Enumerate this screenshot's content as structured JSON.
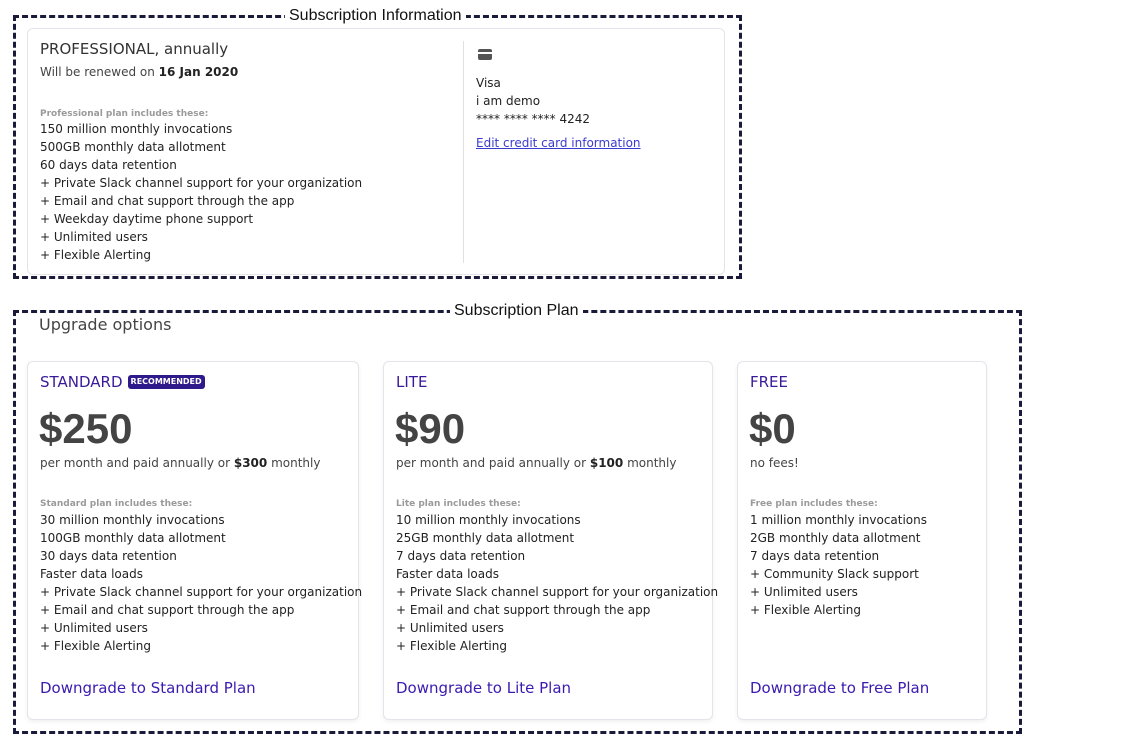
{
  "subscription_info": {
    "section_label": "Subscription Information",
    "current_plan": "PROFESSIONAL, annually",
    "renew_prefix": "Will be renewed on ",
    "renew_date": "16 Jan 2020",
    "includes_title": "Professional plan includes these:",
    "features": [
      "150 million monthly invocations",
      "500GB monthly data allotment",
      "60 days data retention",
      "+ Private Slack channel support for your organization",
      "+ Email and chat support through the app",
      "+ Weekday daytime phone support",
      "+ Unlimited users",
      "+ Flexible Alerting"
    ],
    "payment": {
      "icon": "credit-card-icon",
      "card_brand": "Visa",
      "card_holder": "i am demo",
      "card_number": "**** **** **** 4242",
      "edit_link": "Edit credit card information"
    }
  },
  "subscription_plan": {
    "section_label": "Subscription Plan",
    "upgrade_title": "Upgrade options",
    "plans": [
      {
        "name": "STANDARD",
        "badge": "RECOMMENDED",
        "price": "$250",
        "price_note_prefix": "per month and paid annually or ",
        "price_note_amount": "$300",
        "price_note_suffix": " monthly",
        "includes_title": "Standard plan includes these:",
        "features": [
          "30 million monthly invocations",
          "100GB monthly data allotment",
          "30 days data retention",
          "Faster data loads",
          "+ Private Slack channel support for your organization",
          "+ Email and chat support through the app",
          "+ Unlimited users",
          "+ Flexible Alerting"
        ],
        "action": "Downgrade to Standard Plan"
      },
      {
        "name": "LITE",
        "price": "$90",
        "price_note_prefix": "per month and paid annually or ",
        "price_note_amount": "$100",
        "price_note_suffix": " monthly",
        "includes_title": "Lite plan includes these:",
        "features": [
          "10 million monthly invocations",
          "25GB monthly data allotment",
          "7 days data retention",
          "Faster data loads",
          "+ Private Slack channel support for your organization",
          "+ Email and chat support through the app",
          "+ Unlimited users",
          "+ Flexible Alerting"
        ],
        "action": "Downgrade to Lite Plan"
      },
      {
        "name": "FREE",
        "price": "$0",
        "price_note_prefix": "no fees!",
        "includes_title": "Free plan includes these:",
        "features": [
          "1 million monthly invocations",
          "2GB monthly data allotment",
          "7 days data retention",
          "+ Community Slack support",
          "+ Unlimited users",
          "+ Flexible Alerting"
        ],
        "action": "Downgrade to Free Plan"
      }
    ]
  },
  "colors": {
    "accent": "#3b1ab0",
    "badge_bg": "#2e1a8a",
    "link": "#3b3bd0",
    "dashed_border": "#1a1a3a"
  }
}
